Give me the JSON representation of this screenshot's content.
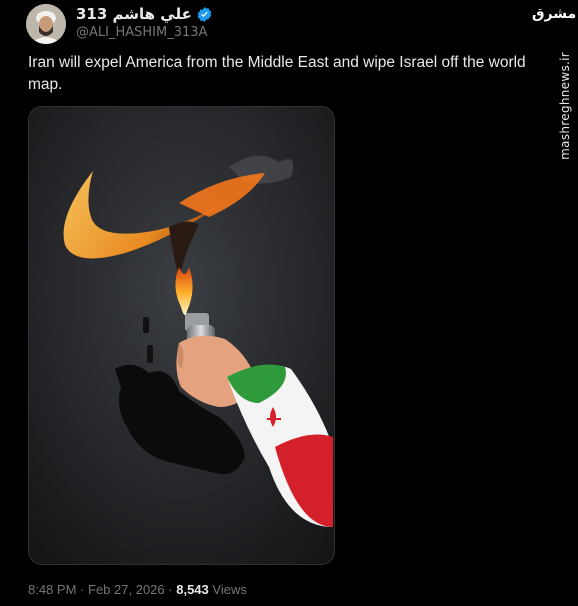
{
  "tweet": {
    "display_name": "علي هاشم 313",
    "handle": "@ALI_HASHIM_313A",
    "text": "Iran will expel America from the Middle East and wipe Israel off the world map.",
    "time": "8:48 PM",
    "separator": "·",
    "date": "Feb 27, 2026",
    "views_count": "8,543",
    "views_label": "Views"
  },
  "watermark": {
    "logo_text": "مشرق",
    "site": "mashreghnews.ir"
  },
  "colors": {
    "background": "#000000",
    "text": "#e7e9ea",
    "muted": "#71767b",
    "verified": "#1d9bf0"
  },
  "icons": [
    "verified-badge-icon",
    "avatar"
  ]
}
